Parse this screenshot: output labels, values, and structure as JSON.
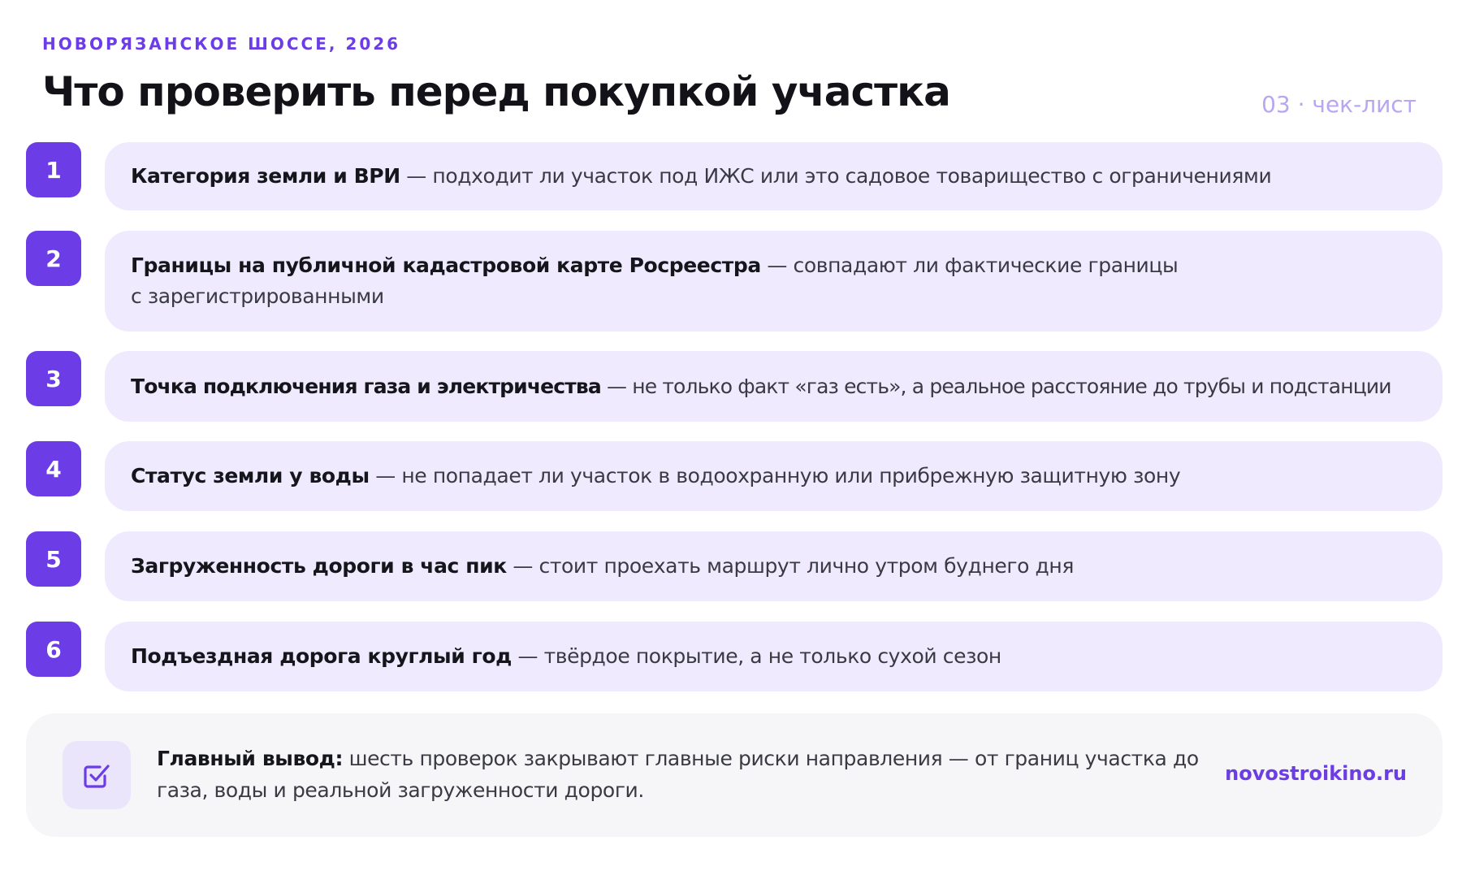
{
  "header": {
    "eyebrow": "НОВОРЯЗАНСКОЕ ШОССЕ, 2026",
    "title": "Что проверить перед покупкой участка",
    "counter": "03 · чек-лист"
  },
  "checklist": [
    {
      "number": "1",
      "heading": "Категория земли и ВРИ",
      "text": " — подходит ли участок под ИЖС или это садовое товарищество с ограничениями"
    },
    {
      "number": "2",
      "heading": "Границы на публичной кадастровой карте Росреестра",
      "text": " — совпадают ли фактические границы с зарегистрированными"
    },
    {
      "number": "3",
      "heading": "Точка подключения газа и электричества",
      "text": " — не только факт «газ есть», а реальное расстояние до трубы и подстанции"
    },
    {
      "number": "4",
      "heading": "Статус земли у воды",
      "text": " — не попадает ли участок в водоохранную или прибрежную защитную зону"
    },
    {
      "number": "5",
      "heading": "Загруженность дороги в час пик",
      "text": " — стоит проехать маршрут лично утром буднего дня"
    },
    {
      "number": "6",
      "heading": "Подъездная дорога круглый год",
      "text": " — твёрдое покрытие, а не только сухой сезон"
    }
  ],
  "summary": {
    "icon": "checkbox-check-icon",
    "heading": "Главный вывод:",
    "text": " шесть проверок закрывают главные риски направления — от границ участка до газа, воды и реальной загруженности дороги.",
    "site": "novostroikino.ru"
  },
  "colors": {
    "accent": "#6c3ce6",
    "card_bg": "#efeafd",
    "summary_bg": "#f6f6f9",
    "counter": "#b9a6f2"
  }
}
